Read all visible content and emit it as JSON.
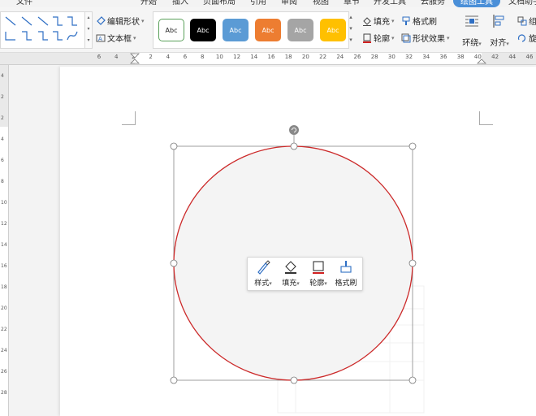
{
  "menu": {
    "items": [
      "文件",
      "开始",
      "插入",
      "页面布局",
      "引用",
      "审阅",
      "视图",
      "章节",
      "开发工具",
      "云服务",
      "绘图工具",
      "文档助手"
    ],
    "active_index": 10
  },
  "ribbon": {
    "edit_shape_label": "编辑形状",
    "text_box_label": "文本框",
    "style_swatches": [
      {
        "label": "Abc",
        "bg": "#ffffff",
        "fg": "#222222",
        "border": "#5aa05a"
      },
      {
        "label": "Abc",
        "bg": "#000000",
        "fg": "#ffffff",
        "border": "#000000"
      },
      {
        "label": "Abc",
        "bg": "#5b9bd5",
        "fg": "#ffffff",
        "border": "#5b9bd5"
      },
      {
        "label": "Abc",
        "bg": "#ed7d31",
        "fg": "#ffffff",
        "border": "#ed7d31"
      },
      {
        "label": "Abc",
        "bg": "#a5a5a5",
        "fg": "#ffffff",
        "border": "#a5a5a5"
      },
      {
        "label": "Abc",
        "bg": "#ffc000",
        "fg": "#ffffff",
        "border": "#ffc000"
      }
    ],
    "fill_label": "填充",
    "format_painter_label": "格式刷",
    "outline_label": "轮廓",
    "shape_effect_label": "形状效果",
    "wrap_label": "环绕",
    "align_label": "对齐",
    "group_label": "组",
    "rotate_label": "旋"
  },
  "ruler": {
    "ticks": [
      "6",
      "4",
      "2",
      "2",
      "4",
      "6",
      "8",
      "10",
      "12",
      "14",
      "16",
      "18",
      "20",
      "22",
      "24",
      "26",
      "28",
      "30",
      "32",
      "34",
      "36",
      "38",
      "40",
      "42",
      "44",
      "46"
    ]
  },
  "vruler": {
    "ticks": [
      "4",
      "2",
      "2",
      "4",
      "6",
      "8",
      "10",
      "12",
      "14",
      "16",
      "18",
      "20",
      "22",
      "24",
      "26",
      "28"
    ]
  },
  "shape": {
    "stroke_color": "#cc2a2a",
    "fill_color": "#f4f4f4"
  },
  "floatbar": {
    "style_label": "样式",
    "fill_label": "填充",
    "outline_label": "轮廓",
    "painter_label": "格式刷"
  }
}
